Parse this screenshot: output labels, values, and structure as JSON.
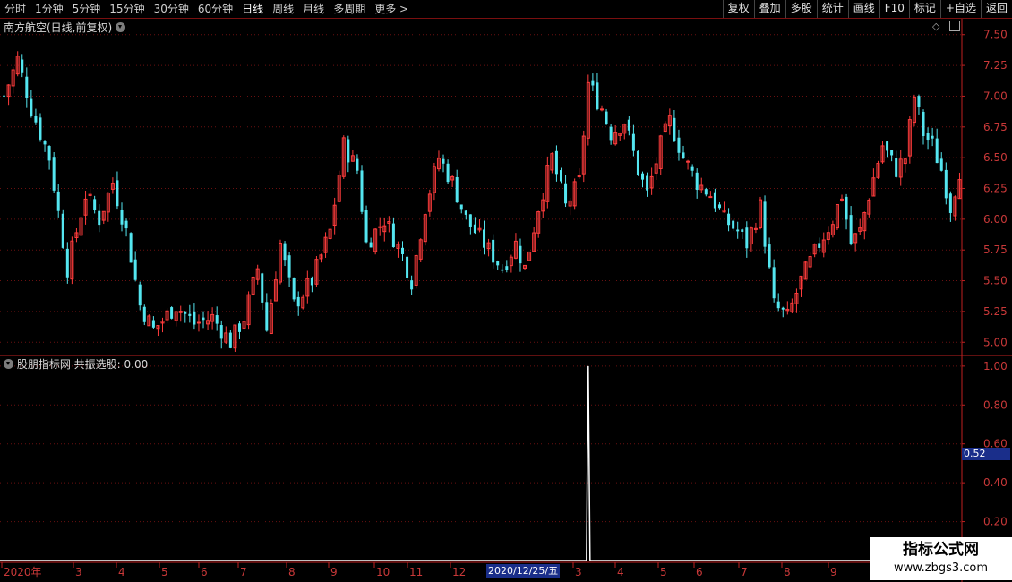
{
  "toolbar": {
    "periods": [
      "分时",
      "1分钟",
      "5分钟",
      "15分钟",
      "30分钟",
      "60分钟",
      "日线",
      "周线",
      "月线",
      "多周期",
      "更多 >"
    ],
    "active_period": "日线",
    "buttons": [
      "复权",
      "叠加",
      "多股",
      "统计",
      "画线",
      "F10",
      "标记",
      "+自选",
      "返回"
    ]
  },
  "main_panel": {
    "title": "南方航空(日线,前复权)"
  },
  "sub_panel": {
    "title": "股朋指标网 共振选股: 0.00"
  },
  "cursor": {
    "date_label": "2020/12/25/五",
    "value_label": "0.52"
  },
  "watermark": {
    "line1": "指标公式网",
    "line2": "www.zbgs3.com"
  },
  "colors": {
    "up": "#ff3c3c",
    "down": "#54e6f0",
    "axis": "#c02020",
    "grid": "#6a1010",
    "signal": "#ffffff",
    "label": "#c83838"
  },
  "chart_data": [
    {
      "type": "candlestick",
      "title": "南方航空(日线,前复权)",
      "y_ticks": [
        5.0,
        5.25,
        5.5,
        5.75,
        6.0,
        6.25,
        6.5,
        6.75,
        7.0,
        7.25,
        7.5
      ],
      "ylim": [
        4.9,
        7.6
      ],
      "x_ticks": [
        "2020年",
        "3",
        "4",
        "5",
        "6",
        "7",
        "8",
        "9",
        "10",
        "11",
        "12",
        "3",
        "4",
        "5",
        "6",
        "7",
        "8",
        "9"
      ],
      "price_path": [
        [
          0,
          7.0
        ],
        [
          3,
          7.3
        ],
        [
          6,
          6.9
        ],
        [
          10,
          6.5
        ],
        [
          14,
          5.6
        ],
        [
          18,
          6.2
        ],
        [
          21,
          6.0
        ],
        [
          24,
          6.3
        ],
        [
          27,
          5.9
        ],
        [
          30,
          5.3
        ],
        [
          33,
          5.1
        ],
        [
          38,
          5.3
        ],
        [
          42,
          5.15
        ],
        [
          46,
          5.2
        ],
        [
          50,
          5.0
        ],
        [
          53,
          5.2
        ],
        [
          56,
          5.6
        ],
        [
          58,
          5.1
        ],
        [
          61,
          5.8
        ],
        [
          64,
          5.3
        ],
        [
          68,
          5.5
        ],
        [
          72,
          5.9
        ],
        [
          75,
          6.6
        ],
        [
          78,
          6.4
        ],
        [
          80,
          5.8
        ],
        [
          84,
          6.0
        ],
        [
          88,
          5.7
        ],
        [
          90,
          5.5
        ],
        [
          93,
          6.1
        ],
        [
          96,
          6.5
        ],
        [
          99,
          6.3
        ],
        [
          102,
          6.0
        ],
        [
          106,
          5.8
        ],
        [
          110,
          5.6
        ],
        [
          113,
          5.8
        ],
        [
          115,
          5.6
        ],
        [
          118,
          6.1
        ],
        [
          121,
          6.5
        ],
        [
          124,
          6.1
        ],
        [
          127,
          6.3
        ],
        [
          129,
          7.1
        ],
        [
          132,
          6.9
        ],
        [
          134,
          6.7
        ],
        [
          137,
          6.8
        ],
        [
          140,
          6.4
        ],
        [
          142,
          6.2
        ],
        [
          145,
          6.6
        ],
        [
          147,
          6.8
        ],
        [
          150,
          6.5
        ],
        [
          153,
          6.3
        ],
        [
          156,
          6.2
        ],
        [
          159,
          6.0
        ],
        [
          162,
          5.9
        ],
        [
          164,
          5.8
        ],
        [
          167,
          6.1
        ],
        [
          170,
          5.3
        ],
        [
          173,
          5.2
        ],
        [
          176,
          5.5
        ],
        [
          180,
          5.8
        ],
        [
          183,
          6.0
        ],
        [
          185,
          6.2
        ],
        [
          187,
          5.8
        ],
        [
          189,
          5.9
        ],
        [
          191,
          6.2
        ],
        [
          194,
          6.6
        ],
        [
          197,
          6.4
        ],
        [
          199,
          6.5
        ],
        [
          201,
          7.0
        ],
        [
          203,
          6.7
        ],
        [
          205,
          6.6
        ],
        [
          207,
          6.4
        ],
        [
          209,
          6.1
        ],
        [
          211,
          6.4
        ]
      ],
      "signal_bar_index": 129
    },
    {
      "type": "line",
      "title": "股朋指标网 共振选股: 0.00",
      "series": [
        {
          "name": "共振选股",
          "spike_at_index": 129,
          "spike_value": 1.0,
          "baseline": 0.0
        }
      ],
      "y_ticks": [
        0.2,
        0.4,
        0.6,
        0.8,
        1.0
      ],
      "ylim": [
        0.0,
        1.05
      ]
    }
  ]
}
